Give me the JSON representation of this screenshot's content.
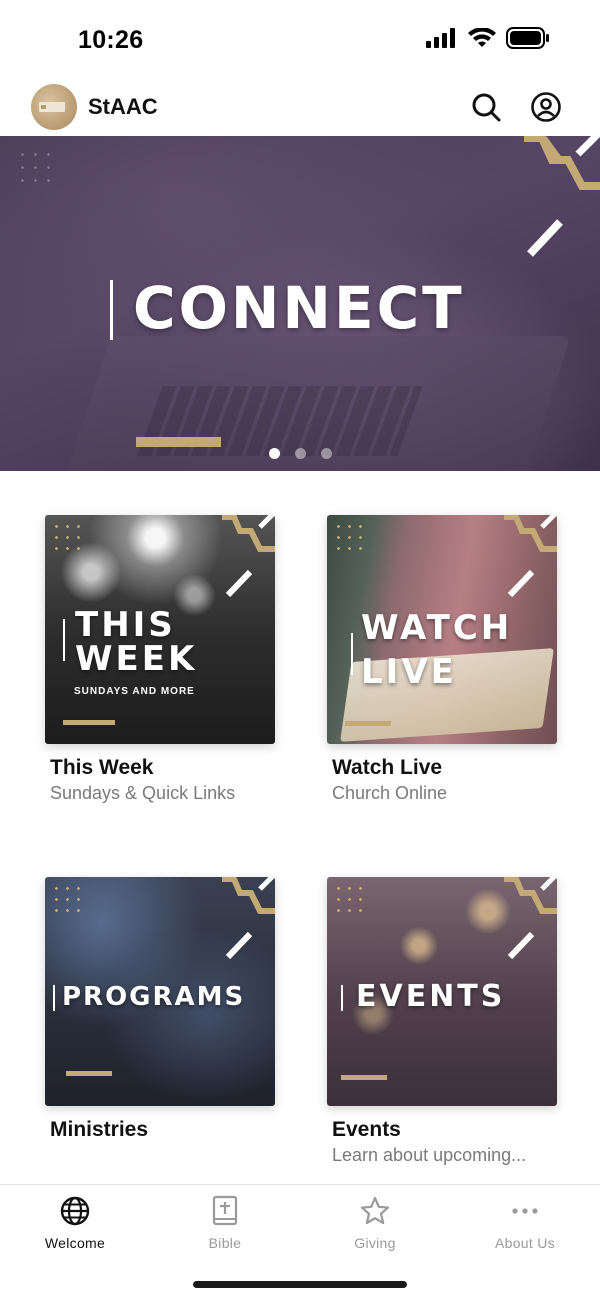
{
  "status_bar": {
    "time": "10:26",
    "icons": [
      "cellular-signal-icon",
      "wifi-icon",
      "battery-icon"
    ]
  },
  "header": {
    "app_name": "StAAC",
    "actions": [
      "search-icon",
      "account-icon"
    ]
  },
  "hero": {
    "title": "CONNECT",
    "pager_count": 3,
    "pager_active_index": 0
  },
  "tiles": [
    {
      "image_text": "THIS\nWEEK",
      "image_subtext": "SUNDAYS AND MORE",
      "title": "This Week",
      "subtitle": "Sundays & Quick Links"
    },
    {
      "image_text": "WATCH\nLIVE",
      "image_subtext": "",
      "title": "Watch Live",
      "subtitle": "Church Online"
    },
    {
      "image_text": "PROGRAMS",
      "image_subtext": "",
      "title": "Ministries",
      "subtitle": ""
    },
    {
      "image_text": "EVENTS",
      "image_subtext": "",
      "title": "Events",
      "subtitle": "Learn about upcoming..."
    }
  ],
  "tabbar": {
    "active_index": 0,
    "tabs": [
      {
        "label": "Welcome",
        "icon": "globe-icon"
      },
      {
        "label": "Bible",
        "icon": "bible-icon"
      },
      {
        "label": "Giving",
        "icon": "star-icon"
      },
      {
        "label": "About Us",
        "icon": "more-icon"
      }
    ]
  },
  "colors": {
    "accent_gold": "#c2a976",
    "hero_purple": "#4f3e5c",
    "tab_inactive": "#9a9a9a"
  }
}
